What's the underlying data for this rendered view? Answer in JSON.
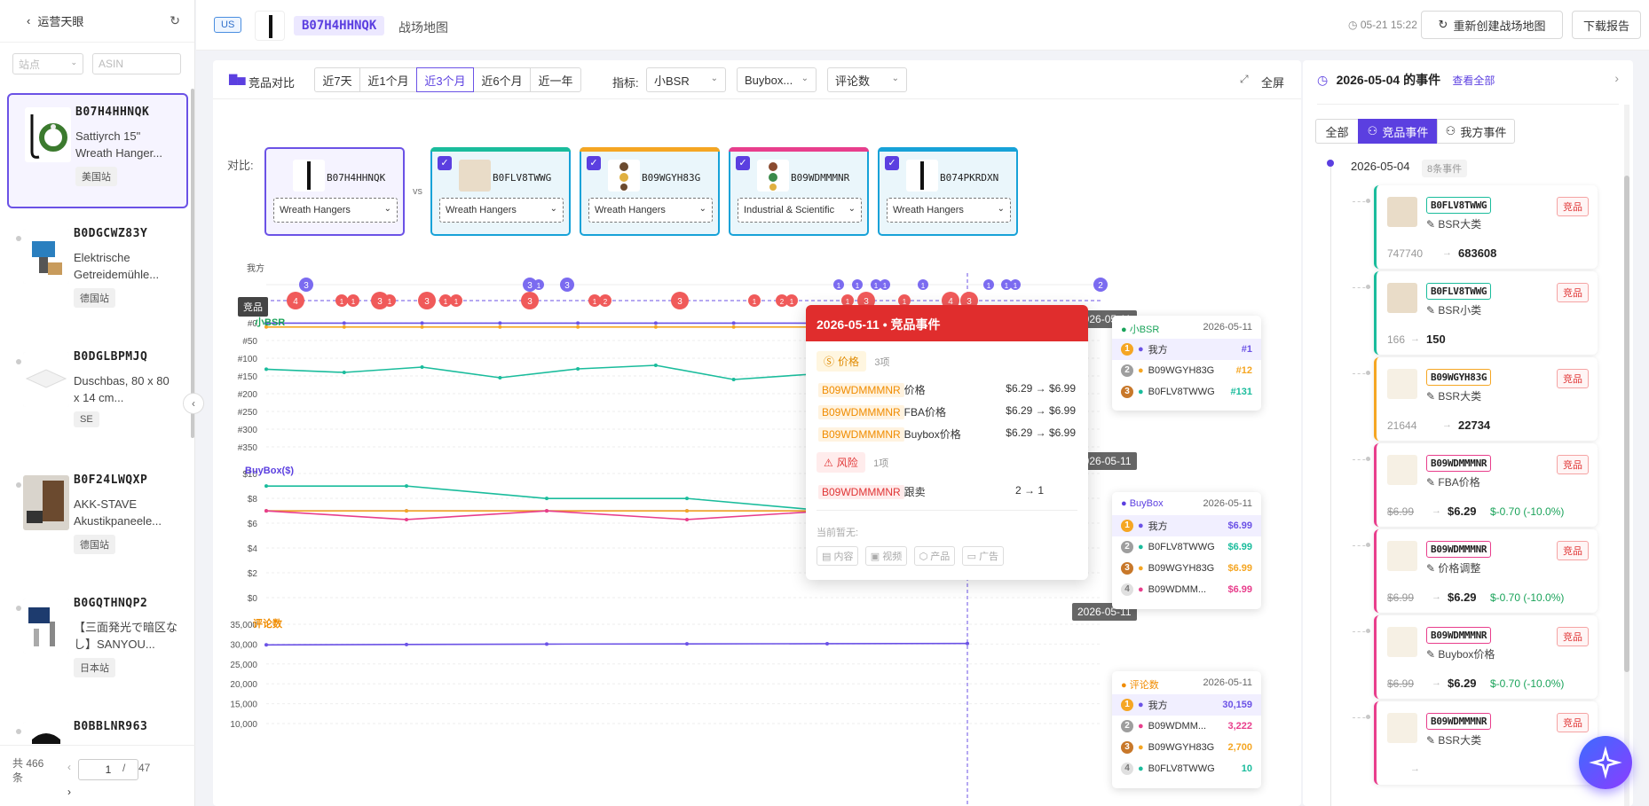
{
  "sidebar": {
    "title": "运营天眼",
    "site_placeholder": "站点",
    "asin_placeholder": "ASIN",
    "items": [
      {
        "asin": "B07H4HHNQK",
        "name": "Sattiyrch 15\" Wreath Hanger...",
        "site": "美国站"
      },
      {
        "asin": "B0DGCWZ83Y",
        "name": "Elektrische Getreidemühle...",
        "site": "德国站"
      },
      {
        "asin": "B0DGLBPMJQ",
        "name": "Duschbas, 80 x 80 x 14 cm...",
        "site": "SE"
      },
      {
        "asin": "B0F24LWQXP",
        "name": "AKK-STAVE Akustikpaneele...",
        "site": "德国站"
      },
      {
        "asin": "B0GQTHNQP2",
        "name": "【三面発光で暗区なし】SANYOU...",
        "site": "日本站"
      },
      {
        "asin": "B0BBLNR963",
        "name": "",
        "site": ""
      }
    ],
    "footer_total": "共 466 条",
    "page_current": "1",
    "page_sep": "/",
    "page_total": "47"
  },
  "header": {
    "marketplace": "US",
    "asin": "B07H4HHNQK",
    "subtitle": "战场地图",
    "timestamp": "05-21 15:22",
    "rebuild_label": "重新创建战场地图",
    "download_label": "下载报告"
  },
  "toolbar": {
    "section_label": "竞品对比",
    "ranges": [
      "近7天",
      "近1个月",
      "近3个月",
      "近6个月",
      "近一年"
    ],
    "active_range": "近3个月",
    "metric_label": "指标:",
    "metric_dropdowns": [
      "小BSR",
      "Buybox...",
      "评论数"
    ],
    "fullscreen_label": "全屏"
  },
  "compare": {
    "label": "对比:",
    "vs": "vs",
    "own": {
      "asin": "B07H4HHNQK",
      "category": "Wreath Hangers"
    },
    "competitors": [
      {
        "asin": "B0FLV8TWWG",
        "category": "Wreath Hangers",
        "color": "#1abc9c"
      },
      {
        "asin": "B09WGYH83G",
        "category": "Wreath Hangers",
        "color": "#f5a623"
      },
      {
        "asin": "B09WDMMMNR",
        "category": "Industrial & Scientific",
        "color": "#e83e8c"
      },
      {
        "asin": "B074PKRDXN",
        "category": "Wreath Hangers",
        "color": "#17a2d8"
      }
    ]
  },
  "chart_labels": {
    "own_row": "我方",
    "comp_row": "竞品",
    "bsr_title": "小BSR",
    "buybox_title": "BuyBox($)",
    "reviews_title": "评论数",
    "cursor_date": "2026-05-11"
  },
  "chart_data": [
    {
      "type": "line",
      "title": "小BSR",
      "y_ticks": [
        "#0",
        "#50",
        "#100",
        "#150",
        "#200",
        "#250",
        "#300",
        "#350"
      ],
      "ylim": [
        0,
        350
      ],
      "inverted": true,
      "series": [
        {
          "name": "我方",
          "color": "#6b52e6",
          "values": [
            1,
            1,
            1,
            1,
            1,
            1,
            1,
            1,
            1,
            1
          ]
        },
        {
          "name": "B09WGYH83G",
          "color": "#f5a623",
          "values": [
            12,
            12,
            12,
            12,
            12,
            12,
            12,
            12,
            12,
            12
          ]
        },
        {
          "name": "B0FLV8TWWG",
          "color": "#1abc9c",
          "values": [
            131,
            140,
            125,
            155,
            130,
            120,
            160,
            145,
            135,
            150
          ]
        }
      ]
    },
    {
      "type": "line",
      "title": "BuyBox($)",
      "y_ticks": [
        "$10",
        "$8",
        "$6",
        "$4",
        "$2",
        "$0"
      ],
      "ylim": [
        0,
        10
      ],
      "series": [
        {
          "name": "我方",
          "color": "#6b52e6",
          "values": [
            6.99,
            6.99,
            6.99,
            6.99,
            6.99,
            6.99
          ]
        },
        {
          "name": "B0FLV8TWWG",
          "color": "#1abc9c",
          "values": [
            8.99,
            8.99,
            7.99,
            7.99,
            6.99,
            6.99
          ]
        },
        {
          "name": "B09WGYH83G",
          "color": "#f5a623",
          "values": [
            6.99,
            6.99,
            6.99,
            6.99,
            6.99,
            6.99
          ]
        },
        {
          "name": "B09WDMMMNR",
          "color": "#e83e8c",
          "values": [
            6.99,
            6.29,
            6.99,
            6.29,
            6.99,
            6.99
          ]
        }
      ]
    },
    {
      "type": "line",
      "title": "评论数",
      "y_ticks": [
        "35,000",
        "30,000",
        "25,000",
        "20,000",
        "15,000",
        "10,000"
      ],
      "ylim": [
        10000,
        35000
      ],
      "series": [
        {
          "name": "我方",
          "color": "#6b52e6",
          "values": [
            29800,
            29900,
            30000,
            30050,
            30100,
            30159
          ]
        }
      ]
    }
  ],
  "event_markers": {
    "own": [
      "3",
      "3",
      "1",
      "3",
      "1",
      "1",
      "1",
      "1",
      "1",
      "1",
      "1",
      "1",
      "2"
    ],
    "comp": [
      "4",
      "1",
      "1",
      "3",
      "1",
      "3",
      "1",
      "1",
      "3",
      "1",
      "2",
      "3",
      "1",
      "2",
      "1",
      "1",
      "3",
      "1",
      "4",
      "3"
    ]
  },
  "tooltip": {
    "title": "2026-05-11 • 竞品事件",
    "price_group": "价格",
    "price_count": "3项",
    "price_rows": [
      {
        "asin": "B09WDMMMNR",
        "type": "价格",
        "change": "$6.29 → $6.99"
      },
      {
        "asin": "B09WDMMMNR",
        "type": "FBA价格",
        "change": "$6.29 → $6.99"
      },
      {
        "asin": "B09WDMMMNR",
        "type": "Buybox价格",
        "change": "$6.29 → $6.99"
      }
    ],
    "risk_group": "风险",
    "risk_count": "1项",
    "risk_rows": [
      {
        "asin": "B09WDMMMNR",
        "type": "跟卖",
        "change": "2 → 1"
      }
    ],
    "none_label": "当前暂无:",
    "none_items": [
      "内容",
      "视频",
      "产品",
      "广告"
    ]
  },
  "legend_bsr": {
    "title": "小BSR",
    "date": "2026-05-11",
    "rows": [
      {
        "rank": "1",
        "name": "我方",
        "value": "#1",
        "color": "#6b52e6"
      },
      {
        "rank": "2",
        "name": "B09WGYH83G",
        "value": "#12",
        "color": "#f5a623"
      },
      {
        "rank": "3",
        "name": "B0FLV8TWWG",
        "value": "#131",
        "color": "#1abc9c"
      }
    ]
  },
  "legend_buybox": {
    "title": "BuyBox",
    "date": "2026-05-11",
    "rows": [
      {
        "rank": "1",
        "name": "我方",
        "value": "$6.99",
        "color": "#6b52e6"
      },
      {
        "rank": "2",
        "name": "B0FLV8TWWG",
        "value": "$6.99",
        "color": "#1abc9c"
      },
      {
        "rank": "3",
        "name": "B09WGYH83G",
        "value": "$6.99",
        "color": "#f5a623"
      },
      {
        "rank": "4",
        "name": "B09WDMM...",
        "value": "$6.99",
        "color": "#e83e8c"
      }
    ]
  },
  "legend_reviews": {
    "title": "评论数",
    "date": "2026-05-11",
    "rows": [
      {
        "rank": "1",
        "name": "我方",
        "value": "30,159",
        "color": "#6b52e6"
      },
      {
        "rank": "2",
        "name": "B09WDMM...",
        "value": "3,222",
        "color": "#e83e8c"
      },
      {
        "rank": "3",
        "name": "B09WGYH83G",
        "value": "2,700",
        "color": "#f5a623"
      },
      {
        "rank": "4",
        "name": "B0FLV8TWWG",
        "value": "10",
        "color": "#1abc9c"
      }
    ]
  },
  "events_panel": {
    "title": "2026-05-04 的事件",
    "view_all": "查看全部",
    "tabs": [
      "全部",
      "竞品事件",
      "我方事件"
    ],
    "active_tab": "竞品事件",
    "date": "2026-05-04",
    "count": "8条事件",
    "events": [
      {
        "asin": "B0FLV8TWWG",
        "tag": "竞品",
        "type": "BSR大类",
        "from": "747740",
        "to": "683608",
        "diff": "",
        "color": "#1abc9c"
      },
      {
        "asin": "B0FLV8TWWG",
        "tag": "竞品",
        "type": "BSR小类",
        "from": "166",
        "to": "150",
        "diff": "",
        "color": "#1abc9c"
      },
      {
        "asin": "B09WGYH83G",
        "tag": "竞品",
        "type": "BSR大类",
        "from": "21644",
        "to": "22734",
        "diff": "",
        "color": "#f5a623"
      },
      {
        "asin": "B09WDMMMNR",
        "tag": "竞品",
        "type": "FBA价格",
        "from": "$6.99",
        "to": "$6.29",
        "diff": "$-0.70 (-10.0%)",
        "color": "#e83e8c"
      },
      {
        "asin": "B09WDMMMNR",
        "tag": "竞品",
        "type": "价格调整",
        "from": "$6.99",
        "to": "$6.29",
        "diff": "$-0.70 (-10.0%)",
        "color": "#e83e8c"
      },
      {
        "asin": "B09WDMMMNR",
        "tag": "竞品",
        "type": "Buybox价格",
        "from": "$6.99",
        "to": "$6.29",
        "diff": "$-0.70 (-10.0%)",
        "color": "#e83e8c"
      },
      {
        "asin": "B09WDMMMNR",
        "tag": "竞品",
        "type": "BSR大类",
        "from": "",
        "to": "",
        "diff": "",
        "color": "#e83e8c"
      }
    ]
  }
}
